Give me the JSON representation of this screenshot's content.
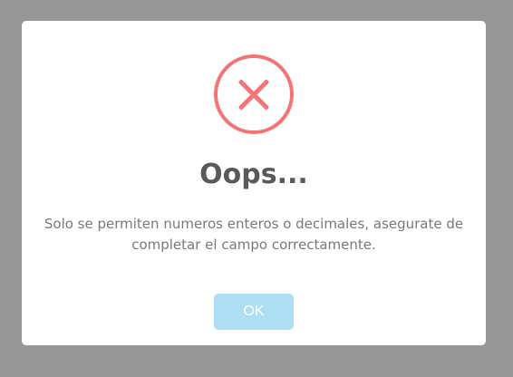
{
  "modal": {
    "icon": "error-x-icon",
    "title": "Oops...",
    "message": "Solo se permiten numeros enteros o decimales, asegurate de completar el campo correctamente.",
    "ok_label": "OK"
  },
  "colors": {
    "overlay": "#979797",
    "icon": "#f27474",
    "button": "#aedef4",
    "title": "#595959",
    "message": "#797979"
  }
}
